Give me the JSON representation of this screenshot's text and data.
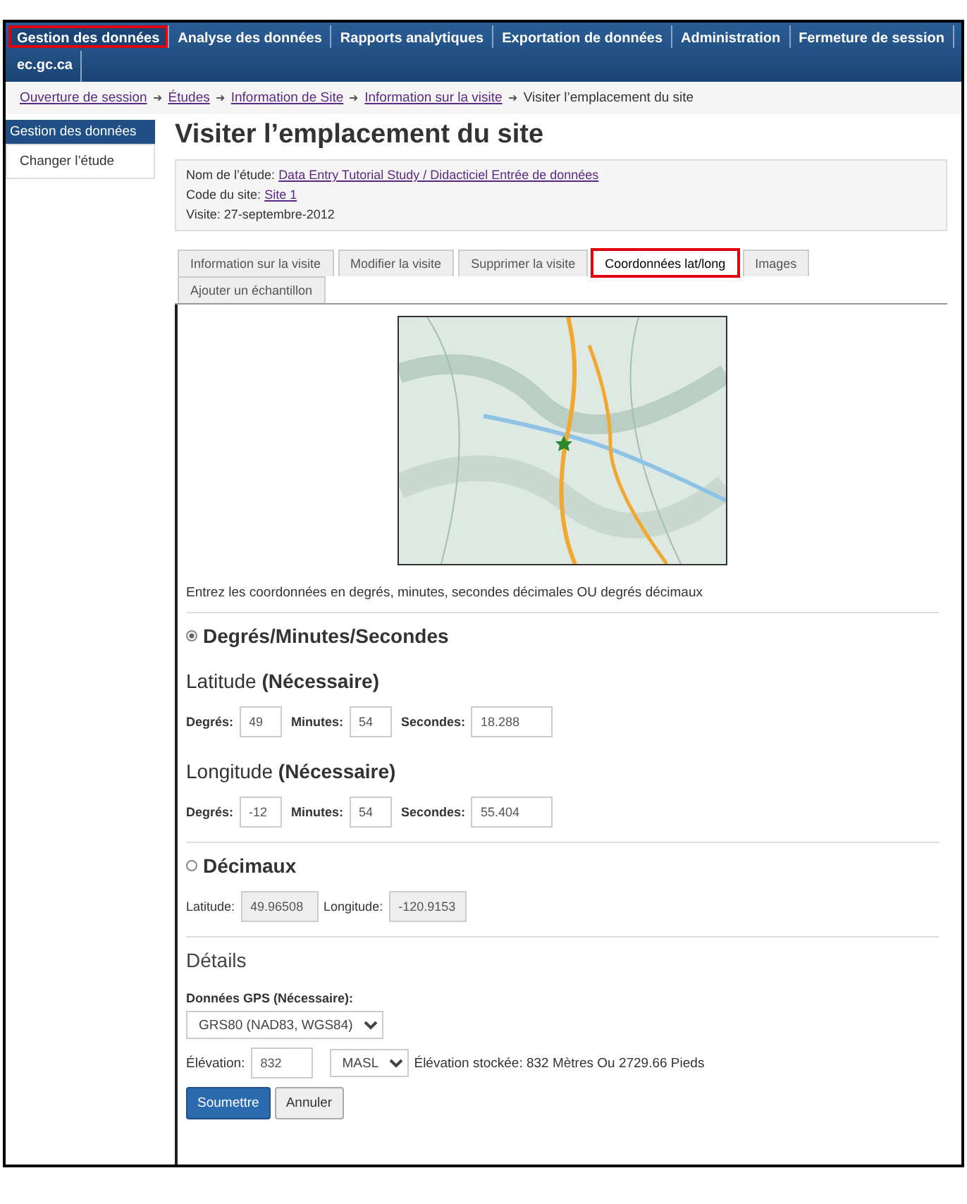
{
  "nav": [
    {
      "label": "Gestion des données",
      "highlighted": true
    },
    {
      "label": "Analyse des données",
      "highlighted": false
    },
    {
      "label": "Rapports analytiques",
      "highlighted": false
    },
    {
      "label": "Exportation de données",
      "highlighted": false
    },
    {
      "label": "Administration",
      "highlighted": false
    },
    {
      "label": "Fermeture de session",
      "highlighted": false
    },
    {
      "label": "ec.gc.ca",
      "highlighted": false
    }
  ],
  "breadcrumb": [
    {
      "label": "Ouverture de session",
      "link": true
    },
    {
      "label": "Études",
      "link": true
    },
    {
      "label": "Information de Site",
      "link": true
    },
    {
      "label": "Information sur la visite",
      "link": true
    },
    {
      "label": "Visiter l’emplacement du site",
      "link": false
    }
  ],
  "breadcrumb_separator": "➜",
  "sidebar": {
    "header": "Gestion des données",
    "items": [
      {
        "label": "Changer l’étude"
      }
    ]
  },
  "title": "Visiter l’emplacement du site",
  "info": [
    {
      "label": "Nom de l’étude:",
      "value": "Data Entry Tutorial Study / Didacticiel Entrée de données",
      "link": true
    },
    {
      "label": "Code du site:",
      "value": "Site 1",
      "link": true
    },
    {
      "label": "Visite:",
      "value": "27-septembre-2012",
      "link": false
    }
  ],
  "tabs": [
    {
      "label": "Information sur la visite",
      "selected": false,
      "highlighted": false
    },
    {
      "label": "Modifier la visite",
      "selected": false,
      "highlighted": false
    },
    {
      "label": "Supprimer la visite",
      "selected": false,
      "highlighted": false
    },
    {
      "label": "Coordonnées lat/long",
      "selected": true,
      "highlighted": true
    },
    {
      "label": "Images",
      "selected": false,
      "highlighted": false
    },
    {
      "label": "Ajouter un échantillon",
      "selected": false,
      "highlighted": false
    }
  ],
  "instructions": "Entrez les coordonnées en degrés, minutes, secondes décimales OU degrés décimaux",
  "dms": {
    "label": "Degrés/Minutes/Secondes",
    "selected": true,
    "groups": [
      {
        "heading": "Latitude **(Nécessaire)**",
        "fields": [
          {
            "label": "Degrés:",
            "value": "49",
            "kind": "short"
          },
          {
            "label": "Minutes:",
            "value": "54",
            "kind": "short"
          },
          {
            "label": "Secondes:",
            "value": "18.288",
            "kind": "long"
          }
        ]
      },
      {
        "heading": "Longitude  **(Nécessaire)**",
        "fields": [
          {
            "label": "Degrés:",
            "value": "-12",
            "kind": "short"
          },
          {
            "label": "Minutes:",
            "value": "54",
            "kind": "short"
          },
          {
            "label": "Secondes:",
            "value": "55.404",
            "kind": "long"
          }
        ]
      }
    ]
  },
  "decimal": {
    "label": "Décimaux",
    "selected": false,
    "fields": [
      {
        "label": "Latitude:",
        "value": "49.96508",
        "disabled": true
      },
      {
        "label": "Longitude:",
        "value": "-120.9153",
        "disabled": true
      }
    ]
  },
  "details": {
    "heading": "Détails",
    "gps_label": "Données GPS (Nécessaire):",
    "gps_value": "GRS80 (NAD83, WGS84)",
    "elevation_label": "Élévation:",
    "elevation_value": "832",
    "unit": "MASL",
    "stored": "Élévation stockée: 832 Mètres Ou 2729.66 Pieds"
  },
  "buttons": [
    {
      "label": "Soumettre",
      "kind": "primary"
    },
    {
      "label": "Annuler",
      "kind": "default"
    }
  ]
}
